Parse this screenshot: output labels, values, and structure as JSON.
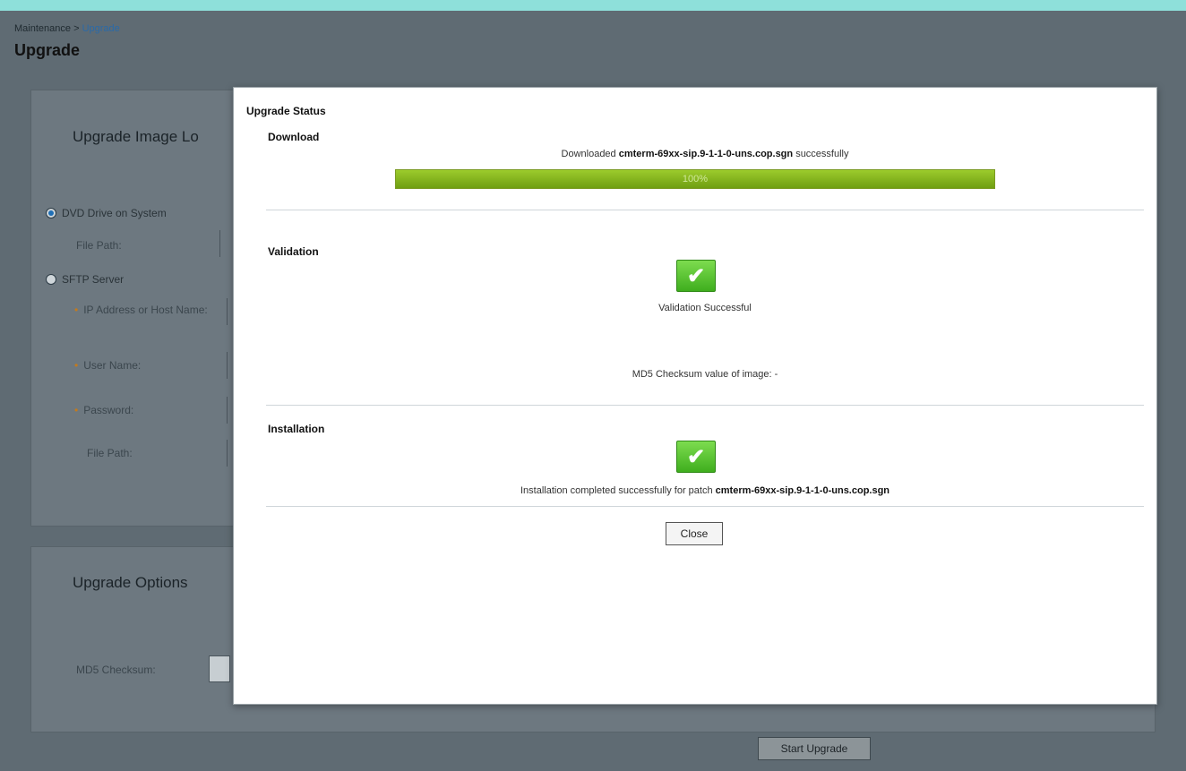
{
  "breadcrumb": {
    "parent": "Maintenance",
    "separator": ">",
    "current": "Upgrade"
  },
  "page_title": "Upgrade",
  "image_location": {
    "heading": "Upgrade Image Lo",
    "option_dvd": "DVD Drive on System",
    "file_path_label": "File Path:",
    "option_sftp": "SFTP Server",
    "ip_label": "IP Address or Host Name:",
    "user_label": "User Name:",
    "password_label": "Password:",
    "sftp_file_path_label": "File Path:"
  },
  "upgrade_options": {
    "heading": "Upgrade Options",
    "md5_label": "MD5 Checksum:"
  },
  "start_upgrade_label": "Start Upgrade",
  "modal": {
    "title": "Upgrade Status",
    "download": {
      "title": "Download",
      "message_prefix": "Downloaded",
      "filename": "cmterm-69xx-sip.9-1-1-0-uns.cop.sgn",
      "message_suffix": "successfully",
      "progress_percent": 100,
      "progress_label": "100%"
    },
    "validation": {
      "title": "Validation",
      "check_symbol": "✔",
      "status": "Validation Successful",
      "md5_text": "MD5 Checksum value of image: -"
    },
    "installation": {
      "title": "Installation",
      "check_symbol": "✔",
      "message_prefix": "Installation completed successfully for patch",
      "filename": "cmterm-69xx-sip.9-1-1-0-uns.cop.sgn"
    },
    "close_label": "Close"
  },
  "colors": {
    "top_bar": "#8ee0da",
    "progress_green": "#7fb21c",
    "check_green": "#4cc02a",
    "overlay_background": "#5f6b73"
  }
}
